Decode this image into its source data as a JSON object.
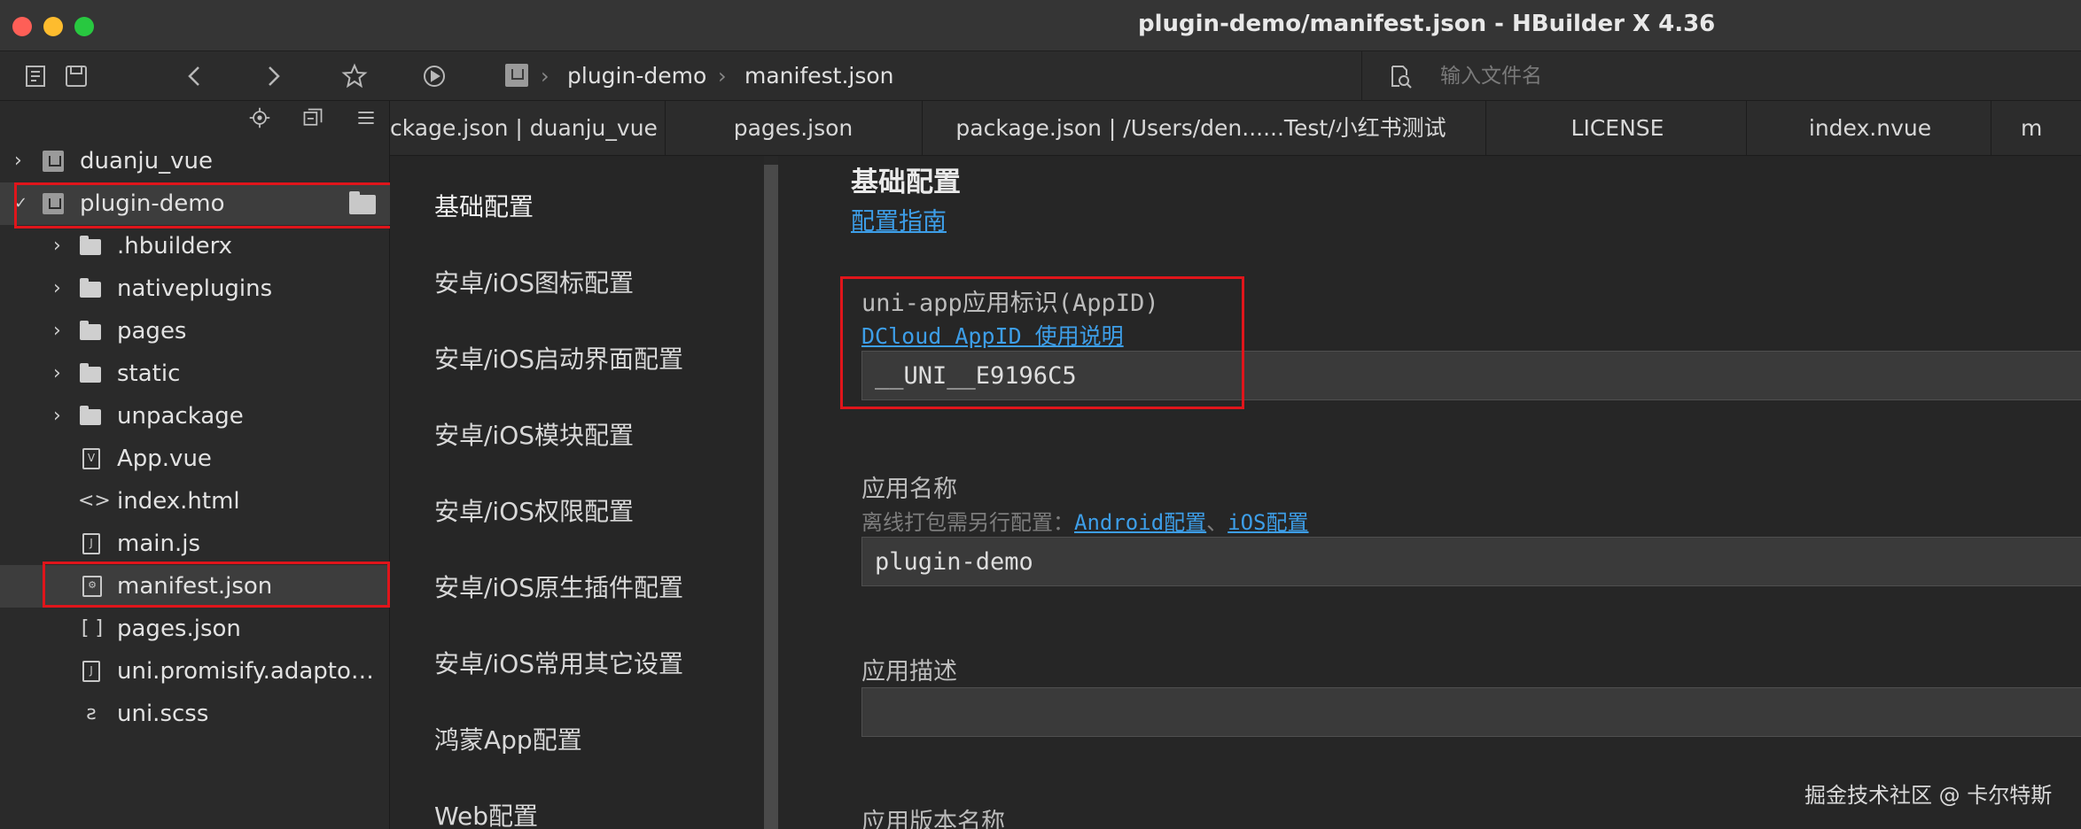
{
  "window": {
    "title": "plugin-demo/manifest.json - HBuilder X 4.36"
  },
  "toolbar": {
    "icons": [
      "new-file-icon",
      "save-icon",
      "back-icon",
      "forward-icon",
      "star-icon",
      "run-icon"
    ],
    "breadcrumb": [
      "plugin-demo",
      "manifest.json"
    ],
    "search_placeholder": "输入文件名"
  },
  "sidebar": {
    "tools": [
      "locate-icon",
      "collapse-icon",
      "menu-icon"
    ],
    "tree": [
      {
        "label": "duanju_vue",
        "type": "project",
        "depth": 0,
        "expanded": false
      },
      {
        "label": "plugin-demo",
        "type": "project",
        "depth": 0,
        "expanded": true,
        "selected": true
      },
      {
        "label": ".hbuilderx",
        "type": "folder",
        "depth": 1
      },
      {
        "label": "nativeplugins",
        "type": "folder",
        "depth": 1
      },
      {
        "label": "pages",
        "type": "folder",
        "depth": 1
      },
      {
        "label": "static",
        "type": "folder",
        "depth": 1
      },
      {
        "label": "unpackage",
        "type": "folder",
        "depth": 1
      },
      {
        "label": "App.vue",
        "type": "vue-file",
        "depth": 1
      },
      {
        "label": "index.html",
        "type": "html-file",
        "depth": 1
      },
      {
        "label": "main.js",
        "type": "js-file",
        "depth": 1
      },
      {
        "label": "manifest.json",
        "type": "manifest-file",
        "depth": 1,
        "selected": true
      },
      {
        "label": "pages.json",
        "type": "json-file",
        "depth": 1
      },
      {
        "label": "uni.promisify.adapto…",
        "type": "js-file",
        "depth": 1
      },
      {
        "label": "uni.scss",
        "type": "scss-file",
        "depth": 1
      }
    ]
  },
  "tabs": [
    "ckage.json | duanju_vue",
    "pages.json",
    "package.json | /Users/den......Test/小红书测试",
    "LICENSE",
    "index.nvue",
    "m"
  ],
  "settings_nav": [
    "基础配置",
    "安卓/iOS图标配置",
    "安卓/iOS启动界面配置",
    "安卓/iOS模块配置",
    "安卓/iOS权限配置",
    "安卓/iOS原生插件配置",
    "安卓/iOS常用其它设置",
    "鸿蒙App配置",
    "Web配置"
  ],
  "content": {
    "section_title": "基础配置",
    "guide_link": "配置指南",
    "appid": {
      "label": "uni-app应用标识(AppID)",
      "help_link": "DCloud AppID 使用说明",
      "value": "__UNI__E9196C5"
    },
    "app_name": {
      "label": "应用名称",
      "sub_prefix": "离线打包需另行配置：",
      "android_link": "Android配置",
      "separator": "、",
      "ios_link": "iOS配置",
      "value": "plugin-demo"
    },
    "app_desc": {
      "label": "应用描述",
      "value": ""
    },
    "version_name": {
      "label": "应用版本名称"
    }
  },
  "watermark": "掘金技术社区 @ 卡尔特斯",
  "colors": {
    "highlight_box": "#e0151b",
    "link": "#3d9ee8",
    "background": "#262626"
  }
}
